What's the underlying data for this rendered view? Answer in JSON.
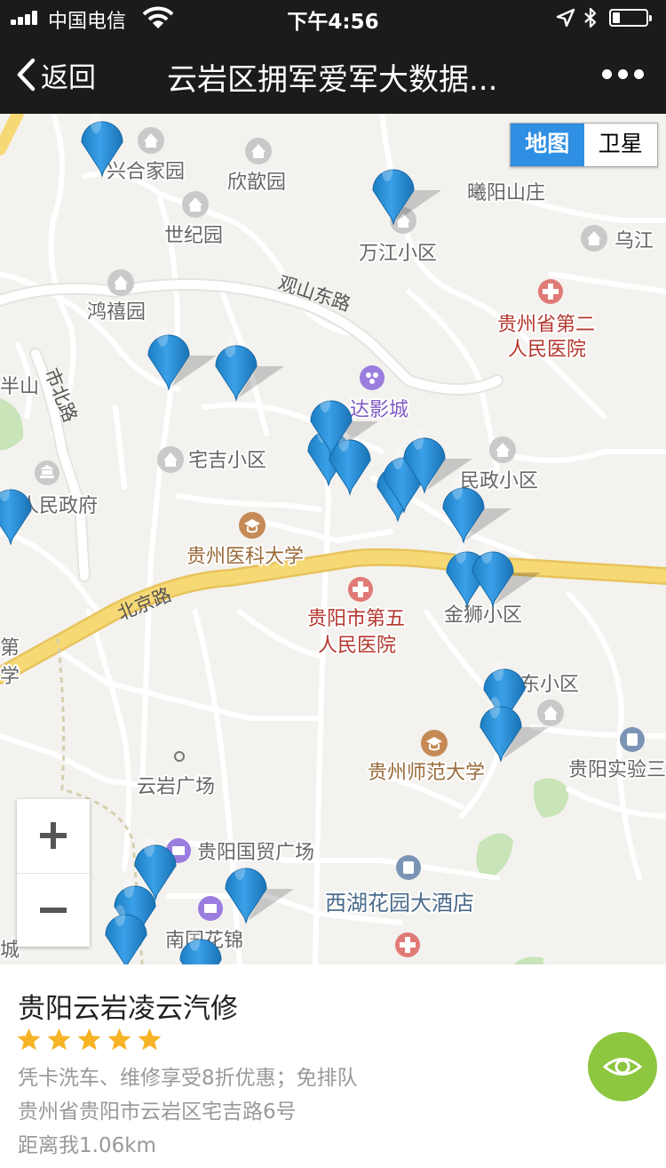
{
  "status_bar": {
    "carrier": "中国电信",
    "time": "下午4:56",
    "battery_level": 0.22
  },
  "nav": {
    "back_label": "返回",
    "title": "云岩区拥军爱军大数据..."
  },
  "map": {
    "type_toggle": {
      "map_label": "地图",
      "satellite_label": "卫星",
      "active": "map"
    },
    "roads": [
      {
        "label": "观山东路"
      },
      {
        "label": "北京路"
      },
      {
        "label": "市北路"
      }
    ],
    "places": [
      {
        "label": "兴合家园",
        "kind": "residential"
      },
      {
        "label": "欣歆园",
        "kind": "residential"
      },
      {
        "label": "世纪园",
        "kind": "residential"
      },
      {
        "label": "万江小区",
        "kind": "residential"
      },
      {
        "label": "曦阳山庄",
        "kind": "residential"
      },
      {
        "label": "乌江",
        "kind": "residential"
      },
      {
        "label": "鸿禧园",
        "kind": "residential"
      },
      {
        "label": "贵州省第二",
        "kind": "hospital"
      },
      {
        "label": "人民医院",
        "kind": "hospital"
      },
      {
        "label": "达影城",
        "kind": "cinema"
      },
      {
        "label": "宅吉小区",
        "kind": "residential"
      },
      {
        "label": "民政小区",
        "kind": "residential"
      },
      {
        "label": "省人民政府",
        "kind": "government"
      },
      {
        "label": "贵州医科大学",
        "kind": "school"
      },
      {
        "label": "贵阳市第五",
        "kind": "hospital"
      },
      {
        "label": "人民医院",
        "kind": "hospital"
      },
      {
        "label": "金狮小区",
        "kind": "residential"
      },
      {
        "label": "东小区",
        "kind": "residential"
      },
      {
        "label": "贵州师范大学",
        "kind": "school"
      },
      {
        "label": "贵阳实验三",
        "kind": "school"
      },
      {
        "label": "云岩广场",
        "kind": "square"
      },
      {
        "label": "贵阳国贸广场",
        "kind": "shopping"
      },
      {
        "label": "西湖花园大酒店",
        "kind": "hotel"
      },
      {
        "label": "南国花锦",
        "kind": "shopping"
      },
      {
        "label": "半山",
        "kind": "area"
      },
      {
        "label": "第",
        "kind": "area"
      },
      {
        "label": "学",
        "kind": "area"
      },
      {
        "label": "城",
        "kind": "area"
      }
    ],
    "marker_count": 26,
    "zoom": {
      "in_symbol": "+",
      "out_symbol": "−"
    }
  },
  "info_card": {
    "name": "贵阳云岩凌云汽修",
    "rating": 5,
    "rating_max": 5,
    "offer": "凭卡洗车、维修享受8折优惠；免排队",
    "address": "贵州省贵阳市云岩区宅吉路6号",
    "distance": "距离我1.06km"
  },
  "colors": {
    "bar_bg": "#1b1b1b",
    "marker": "#2d8fd6",
    "star": "#f5b325",
    "eye_button": "#8dc63f",
    "map_toggle_active": "#2e8fe3",
    "main_road": "#f6d975",
    "label_poi": "#666666",
    "label_hospital": "#b4382f",
    "label_school": "#9a6a3a",
    "label_cinema": "#7e5bc5",
    "label_hotel": "#4a6a8a"
  },
  "icons": {
    "back": "chevron-left-icon",
    "more": "more-dots-icon",
    "view": "eye-icon",
    "star": "star-icon",
    "marker": "map-marker-icon",
    "residential": "house-icon",
    "hospital": "hospital-cross-icon",
    "school": "school-icon",
    "cinema": "cinema-icon"
  }
}
